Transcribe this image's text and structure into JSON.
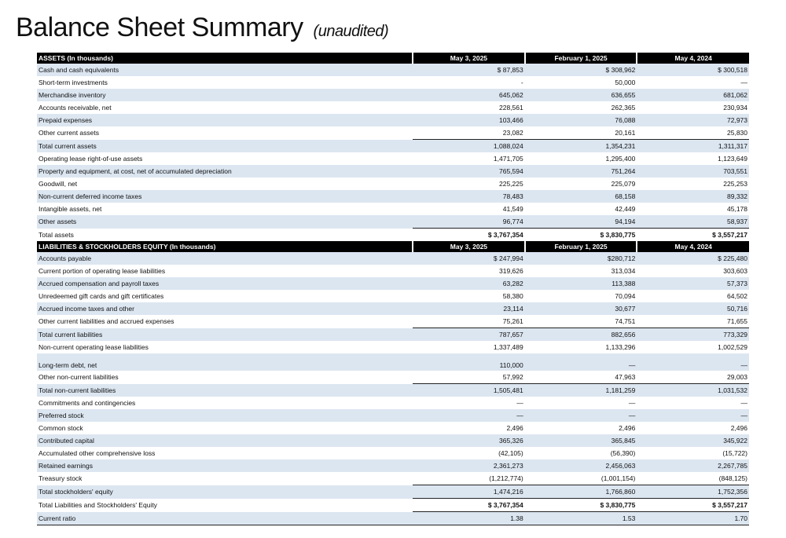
{
  "page": {
    "title": "Balance Sheet Summary",
    "subtitle": "(unaudited)"
  },
  "assets_header": {
    "label": "ASSETS (In thousands)",
    "cols": [
      "May 3, 2025",
      "February 1, 2025",
      "May 4, 2024"
    ]
  },
  "assets_rows": [
    {
      "label": "Cash and cash equivalents",
      "v": [
        "$ 87,853",
        "$ 308,962",
        "$ 300,518"
      ]
    },
    {
      "label": "Short-term investments",
      "v": [
        "-",
        "50,000",
        "—"
      ]
    },
    {
      "label": "Merchandise inventory",
      "v": [
        "645,062",
        "636,655",
        "681,062"
      ]
    },
    {
      "label": "Accounts receivable, net",
      "v": [
        "228,561",
        "262,365",
        "230,934"
      ]
    },
    {
      "label": "Prepaid expenses",
      "v": [
        "103,466",
        "76,088",
        "72,973"
      ]
    },
    {
      "label": "Other current assets",
      "v": [
        "23,082",
        "20,161",
        "25,830"
      ]
    },
    {
      "label": "Total current assets",
      "v": [
        "1,088,024",
        "1,354,231",
        "1,311,317"
      ]
    },
    {
      "label": "Operating lease right-of-use assets",
      "v": [
        "1,471,705",
        "1,295,400",
        "1,123,649"
      ]
    },
    {
      "label": "Property and equipment, at cost, net of accumulated depreciation",
      "v": [
        "765,594",
        "751,264",
        "703,551"
      ]
    },
    {
      "label": "Goodwill, net",
      "v": [
        "225,225",
        "225,079",
        "225,253"
      ]
    },
    {
      "label": "Non-current deferred income taxes",
      "v": [
        "78,483",
        "68,158",
        "89,332"
      ]
    },
    {
      "label": "Intangible assets, net",
      "v": [
        "41,549",
        "42,449",
        "45,178"
      ]
    },
    {
      "label": "Other assets",
      "v": [
        "96,774",
        "94,194",
        "58,937"
      ]
    },
    {
      "label": "Total assets",
      "v": [
        "$ 3,767,354",
        "$ 3,830,775",
        "$ 3,557,217"
      ]
    }
  ],
  "liab_header": {
    "label": "LIABILITIES & STOCKHOLDERS EQUITY (In thousands)",
    "cols": [
      "May 3, 2025",
      "February 1, 2025",
      "May 4, 2024"
    ]
  },
  "liab_rows": [
    {
      "label": "Accounts payable",
      "v": [
        "$ 247,994",
        "$280,712",
        "$ 225,480"
      ]
    },
    {
      "label": "Current portion of operating lease liabilities",
      "v": [
        "319,626",
        "313,034",
        "303,603"
      ]
    },
    {
      "label": "Accrued compensation and payroll taxes",
      "v": [
        "63,282",
        "113,388",
        "57,373"
      ]
    },
    {
      "label": "Unredeemed gift cards and gift certificates",
      "v": [
        "58,380",
        "70,094",
        "64,502"
      ]
    },
    {
      "label": "Accrued income taxes and other",
      "v": [
        "23,114",
        "30,677",
        "50,716"
      ]
    },
    {
      "label": "Other current liabilities and accrued expenses",
      "v": [
        "75,261",
        "74,751",
        "71,655"
      ]
    },
    {
      "label": "Total current liabilities",
      "v": [
        "787,657",
        "882,656",
        "773,329"
      ]
    },
    {
      "label": "Non-current operating lease liabilities",
      "v": [
        "1,337,489",
        "1,133,296",
        "1,002,529"
      ]
    },
    {
      "label": "Long-term debt, net",
      "v": [
        "110,000",
        "—",
        "—"
      ]
    },
    {
      "label": "Other non-current liabilities",
      "v": [
        "57,992",
        "47,963",
        "29,003"
      ]
    },
    {
      "label": "Total non-current liabilities",
      "v": [
        "1,505,481",
        "1,181,259",
        "1,031,532"
      ]
    },
    {
      "label": "Commitments and contingencies",
      "v": [
        "—",
        "—",
        "—"
      ]
    },
    {
      "label": "Preferred stock",
      "v": [
        "—",
        "—",
        "—"
      ]
    },
    {
      "label": "Common stock",
      "v": [
        "2,496",
        "2,496",
        "2,496"
      ]
    },
    {
      "label": "Contributed capital",
      "v": [
        "365,326",
        "365,845",
        "345,922"
      ]
    },
    {
      "label": "Accumulated other comprehensive loss",
      "v": [
        "(42,105)",
        "(56,390)",
        "(15,722)"
      ]
    },
    {
      "label": "Retained earnings",
      "v": [
        "2,361,273",
        "2,456,063",
        "2,267,785"
      ]
    },
    {
      "label": "Treasury stock",
      "v": [
        "(1,212,774)",
        "(1,001,154)",
        "(848,125)"
      ]
    },
    {
      "label": "Total stockholders' equity",
      "v": [
        "1,474,216",
        "1,766,860",
        "1,752,356"
      ]
    },
    {
      "label": "Total Liabilities and Stockholders' Equity",
      "v": [
        "$ 3,767,354",
        "$ 3,830,775",
        "$ 3,557,217"
      ]
    },
    {
      "label": "Current ratio",
      "v": [
        "1.38",
        "1.53",
        "1.70"
      ]
    }
  ]
}
